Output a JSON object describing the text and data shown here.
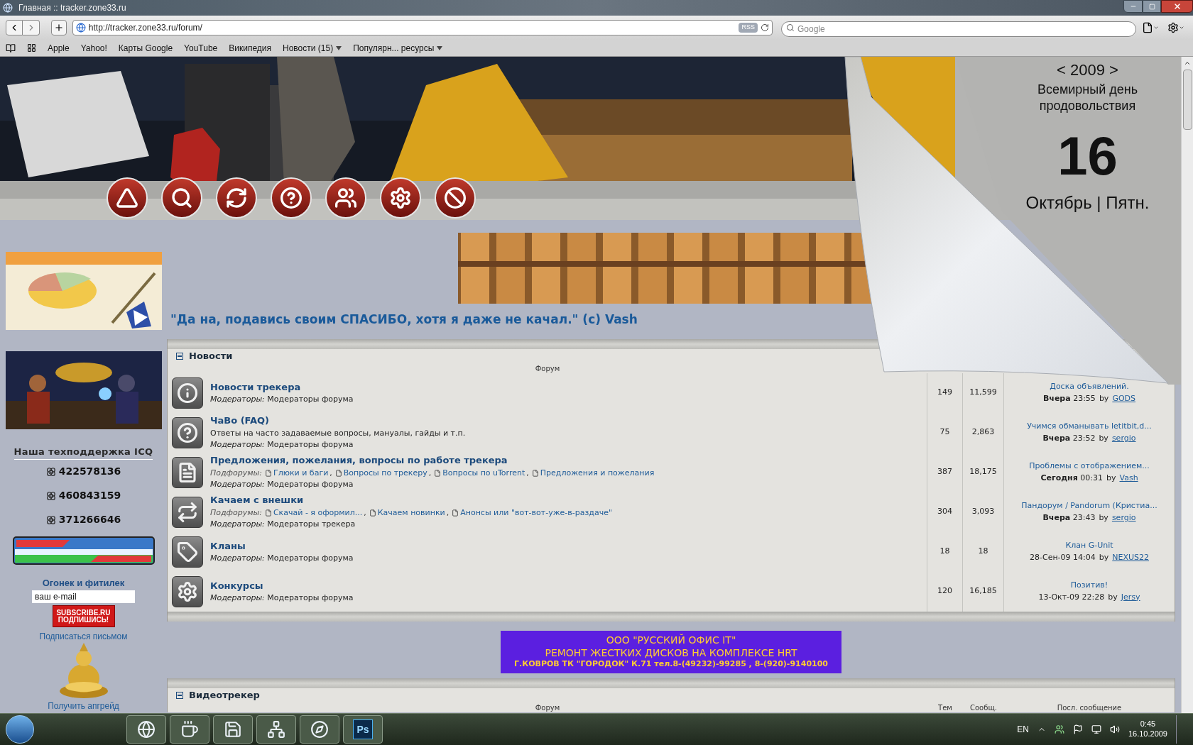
{
  "window": {
    "title": "Главная :: tracker.zone33.ru"
  },
  "toolbar": {
    "address": "http://tracker.zone33.ru/forum/",
    "rss_badge": "RSS",
    "search": {
      "placeholder": "Google"
    }
  },
  "bookmarks": [
    {
      "label": "Apple",
      "kind": "link"
    },
    {
      "label": "Yahoo!",
      "kind": "link"
    },
    {
      "label": "Карты Google",
      "kind": "link"
    },
    {
      "label": "YouTube",
      "kind": "link"
    },
    {
      "label": "Википедия",
      "kind": "link"
    },
    {
      "label": "Новости (15)",
      "kind": "menu"
    },
    {
      "label": "Популярн... ресурсы",
      "kind": "menu"
    }
  ],
  "calendar": {
    "year_nav": "< 2009 >",
    "holiday": "Всемирный день продовольствия",
    "day": "16",
    "month_weekday": "Октябрь | Пятн."
  },
  "sidebar": {
    "icq_title": "Наша техподдержка ICQ",
    "icq_numbers": [
      "422578136",
      "460843159",
      "371266646"
    ],
    "subscribe_title": "Огонек и фитилек",
    "email_value": "ваш e-mail",
    "subscribe_button": [
      "SUBSCRIBE.RU",
      "ПОДПИШИСЬ!"
    ],
    "subscribe_link": "Подписаться письмом",
    "upgrade_link": "Получить апгрейд"
  },
  "quote": "\"Да на, подавись своим СПАСИБО, хотя я даже не качал.\" (c) Vash",
  "categories": [
    {
      "title": "Новости",
      "expanded": true,
      "columns": {
        "forum": "Форум"
      },
      "forums": [
        {
          "kind": "info",
          "title": "Новости трекера",
          "moderators": "*Модераторы:* Модераторы форума",
          "topics": "149",
          "posts": "11,599",
          "last_post": {
            "title": "Доска объявлений.",
            "date": "**Вчера** 23:55",
            "by": "by",
            "author": "GODS"
          }
        },
        {
          "kind": "question",
          "title": "ЧаВо (FAQ)",
          "description": "Ответы на часто задаваемые вопросы, мануалы, гайды и т.п.",
          "moderators": "*Модераторы:* Модераторы форума",
          "topics": "75",
          "posts": "2,863",
          "last_post": {
            "title": "Учимся обманывать letitbit,d...",
            "date": "**Вчера** 23:52",
            "by": "by",
            "author": "sergio"
          }
        },
        {
          "kind": "document",
          "title": "Предложения, пожелания, вопросы по работе трекера",
          "subforums_label": "Подфорумы:",
          "subforums": [
            {
              "name": "Глюки и баги",
              "sep": ","
            },
            {
              "name": "Вопросы по трекеру",
              "sep": ","
            },
            {
              "name": "Вопросы по uTorrent",
              "sep": ","
            },
            {
              "name": "Предложения и пожелания"
            }
          ],
          "moderators": "*Модераторы:* Модераторы форума",
          "topics": "387",
          "posts": "18,175",
          "last_post": {
            "title": "Проблемы с отображением...",
            "date": "**Сегодня** 00:31",
            "by": "by",
            "author": "Vash"
          }
        },
        {
          "kind": "arrows",
          "title": "Качаем с внешки",
          "subforums_label": "Подфорумы:",
          "subforums": [
            {
              "name": "Скачай - я оформил...",
              "sep": ","
            },
            {
              "name": "Качаем новинки",
              "sep": ","
            },
            {
              "name": "Анонсы или \"вот-вот-уже-в-раздаче\""
            }
          ],
          "moderators": "*Модераторы:* Модераторы трекера",
          "topics": "304",
          "posts": "3,093",
          "last_post": {
            "title": "Пандорум / Pandorum (Кристиа...",
            "date": "**Вчера** 23:43",
            "by": "by",
            "author": "sergio"
          }
        },
        {
          "kind": "tag",
          "title": "Кланы",
          "moderators": "*Модераторы:* Модераторы форума",
          "topics": "18",
          "posts": "18",
          "last_post": {
            "title": "Клан G-Unit",
            "date": "28-Сен-09 14:04",
            "by": "by",
            "author": "NEXUS22"
          }
        },
        {
          "kind": "gear",
          "title": "Конкурсы",
          "moderators": "*Модераторы:* Модераторы форума",
          "topics": "120",
          "posts": "16,185",
          "last_post": {
            "title": "Позитив!",
            "date": "13-Окт-09 22:28",
            "by": "by",
            "author": "Jersy"
          }
        }
      ]
    },
    {
      "title": "Видеотрекер",
      "expanded": true,
      "columns": {
        "forum": "Форум",
        "topics": "Тем",
        "posts": "Сообщ.",
        "last_post": "Посл. сообщение"
      }
    }
  ],
  "ad": {
    "lines": [
      "ООО \"РУССКИЙ ОФИС IT\"",
      "РЕМОНТ ЖЕСТКИХ ДИСКОВ НА КОМПЛЕКСЕ HRT",
      "Г.КОВРОВ ТК \"ГОРОДОК\" К.71 тел.8-(49232)-99285 , 8-(920)-9140100"
    ]
  },
  "taskbar": {
    "apps": [
      {
        "kind": "browser"
      },
      {
        "kind": "coffee"
      },
      {
        "kind": "floppy"
      },
      {
        "kind": "network"
      },
      {
        "kind": "compass"
      },
      {
        "kind": "photoshop",
        "label": "Ps"
      }
    ],
    "language": "EN",
    "time": "0:45",
    "date": "16.10.2009"
  }
}
